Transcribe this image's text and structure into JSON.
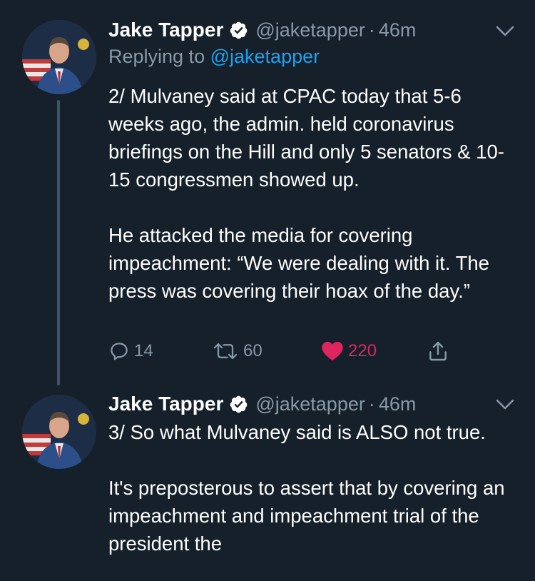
{
  "colors": {
    "background": "#15202b",
    "text_primary": "#ffffff",
    "text_secondary": "#8899a6",
    "link": "#1da1f2",
    "verified": "#ffffff",
    "like_active": "#e0245e",
    "thread_line": "#3d5466"
  },
  "tweets": [
    {
      "author_name": "Jake Tapper",
      "handle": "@jaketapper",
      "separator": "·",
      "time": "46m",
      "replying_prefix": "Replying to",
      "replying_handle": "@jaketapper",
      "verified_icon": "verified-badge-icon",
      "menu_icon": "chevron-down-icon",
      "paragraphs": [
        "2/ Mulvaney said at CPAC today that 5-6 weeks ago, the admin. held coronavirus briefings on the Hill and only 5 senators & 10-15 congressmen showed up.",
        "He attacked the media for covering impeachment: “We were dealing with it. The press was covering their hoax of the day.”"
      ],
      "actions": {
        "reply_count": "14",
        "retweet_count": "60",
        "like_count": "220",
        "liked": true
      }
    },
    {
      "author_name": "Jake Tapper",
      "handle": "@jaketapper",
      "separator": "·",
      "time": "46m",
      "verified_icon": "verified-badge-icon",
      "menu_icon": "chevron-down-icon",
      "paragraphs": [
        "3/ So what Mulvaney said is ALSO not true.",
        "It's preposterous to assert that by covering an impeachment and impeachment trial of the president the"
      ]
    }
  ]
}
